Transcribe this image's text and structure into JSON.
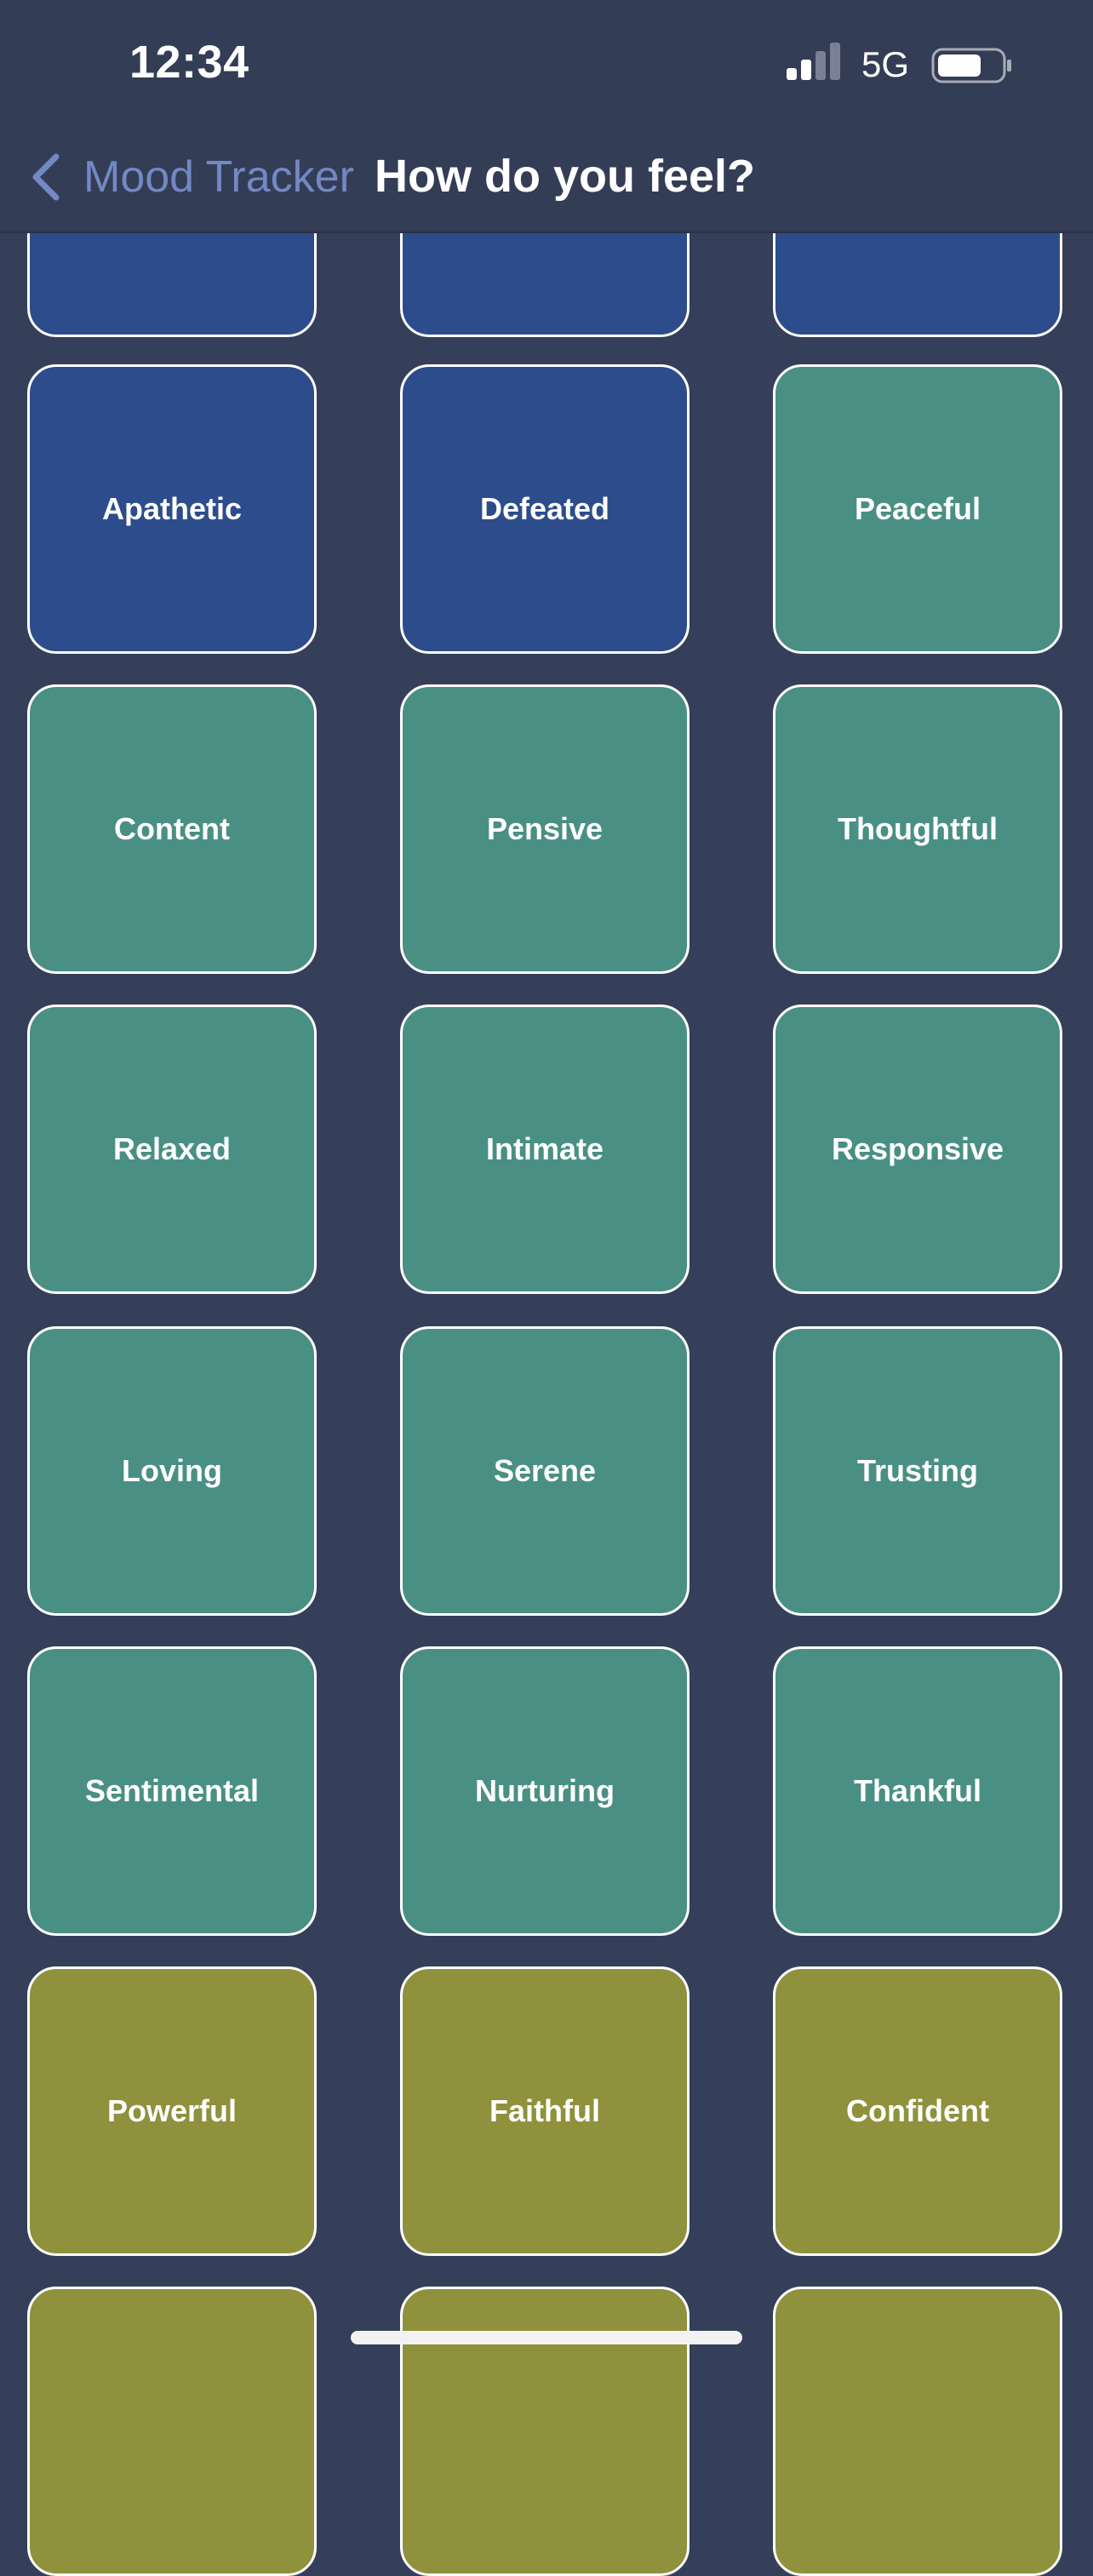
{
  "status_bar": {
    "time": "12:34",
    "network": "5G",
    "signal_icon": "cellular-signal-icon",
    "battery_icon": "battery-icon"
  },
  "nav": {
    "back_label": "Mood Tracker",
    "back_icon": "chevron-left-icon",
    "title": "How do you feel?"
  },
  "colors": {
    "background": "#353f59",
    "blue": "#2d4c8c",
    "teal": "#4a8f84",
    "olive": "#8f913c",
    "accent_link": "#7388c4"
  },
  "moods": {
    "row0": [
      "",
      "",
      ""
    ],
    "row1": [
      "Apathetic",
      "Defeated",
      "Peaceful"
    ],
    "row2": [
      "Content",
      "Pensive",
      "Thoughtful"
    ],
    "row3": [
      "Relaxed",
      "Intimate",
      "Responsive"
    ],
    "row4": [
      "Loving",
      "Serene",
      "Trusting"
    ],
    "row5": [
      "Sentimental",
      "Nurturing",
      "Thankful"
    ],
    "row6": [
      "Powerful",
      "Faithful",
      "Confident"
    ],
    "row7": [
      "",
      "",
      ""
    ]
  }
}
